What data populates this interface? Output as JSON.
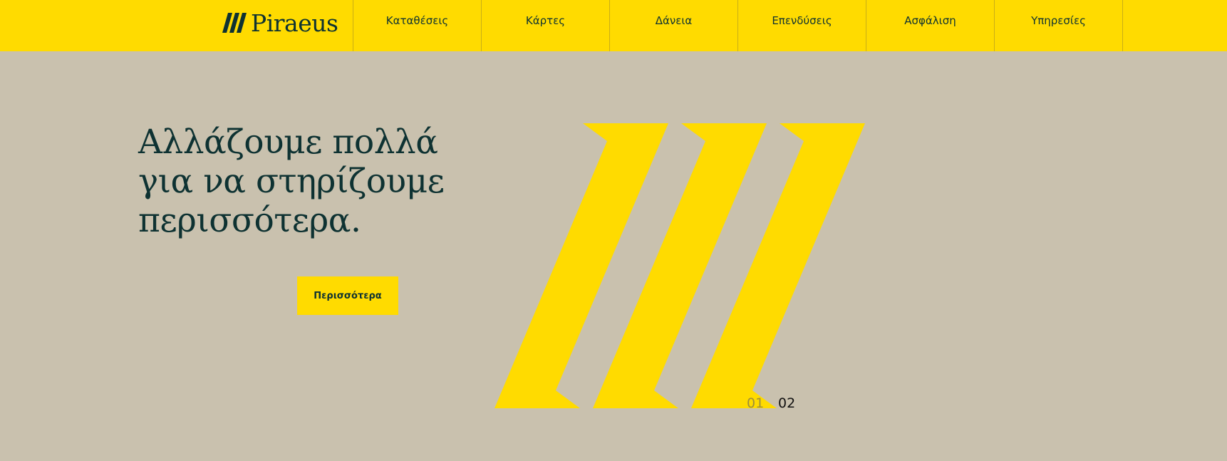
{
  "header": {
    "brand": {
      "name": "Piraeus",
      "logo_icon": "triple-slash-logo-icon"
    },
    "nav": [
      {
        "label": "Καταθέσεις"
      },
      {
        "label": "Κάρτες"
      },
      {
        "label": "Δάνεια"
      },
      {
        "label": "Επενδύσεις"
      },
      {
        "label": "Ασφάλιση"
      },
      {
        "label": "Υπηρεσίες"
      }
    ]
  },
  "hero": {
    "headline_lines": [
      "Αλλάζουμε πολλά",
      "για να στηρίζουμε",
      "περισσότερα."
    ],
    "cta_label": "Περισσότερα",
    "art_icon": "triple-slash-art",
    "slides": [
      {
        "label": "01",
        "active": false
      },
      {
        "label": "02",
        "active": true
      }
    ]
  },
  "colors": {
    "brand_yellow": "#FFDB00",
    "hero_background": "#C9C1AE",
    "text_dark": "#0E3232",
    "nav_divider": "#C9AE17",
    "slide_inactive": "#9E8F3A",
    "slide_active": "#111111"
  }
}
